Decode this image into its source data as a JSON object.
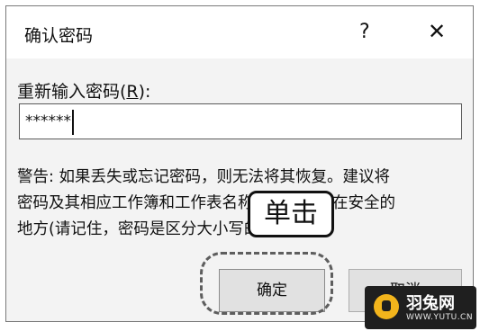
{
  "dialog": {
    "title": "确认密码",
    "help_label": "?",
    "close_label": "✕",
    "field_label_prefix": "重新输入密码(",
    "field_label_access_key": "R",
    "field_label_suffix": "):",
    "password_value": "******",
    "warning_lines": [
      "警告: 如果丢失或忘记密码，则无法将其恢复。建议将",
      "密码及其相应工作簿和工作表名称的列表保存在安全的",
      "地方(请记住，密码是区分大小写的)。"
    ],
    "ok_label": "确定",
    "cancel_label": "取消"
  },
  "annotation": {
    "callout_text": "单击"
  },
  "watermark": {
    "name": "羽兔网",
    "url": "WWW.YUTU.CN"
  }
}
